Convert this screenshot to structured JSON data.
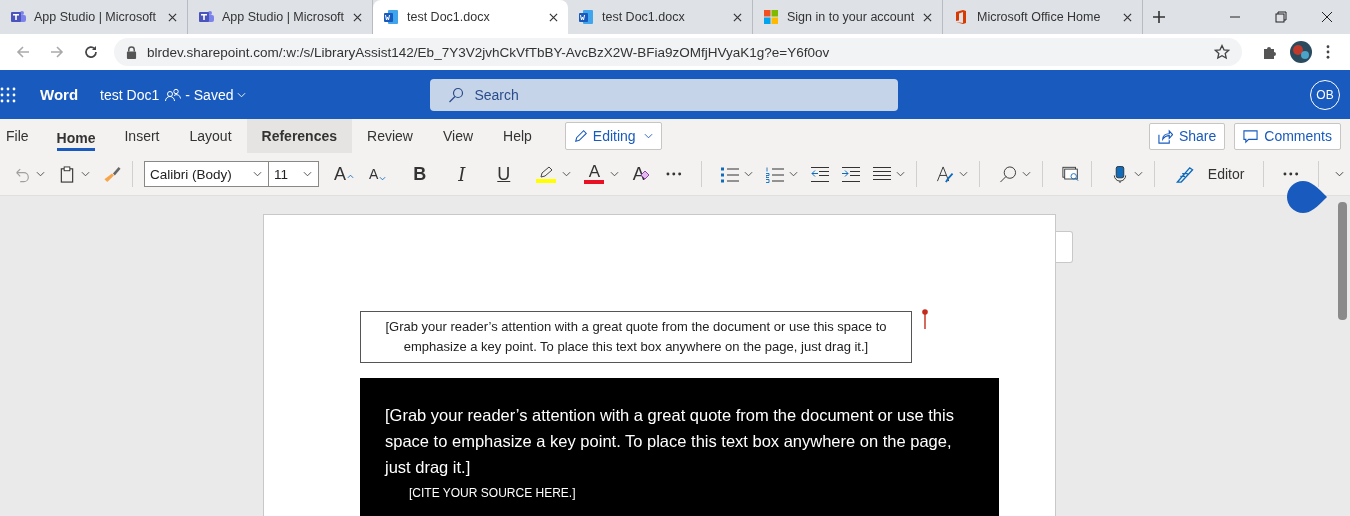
{
  "browser": {
    "tabs": [
      {
        "title": "App Studio | Microsoft",
        "kind": "teams",
        "selected": false
      },
      {
        "title": "App Studio | Microsoft",
        "kind": "teams",
        "selected": false
      },
      {
        "title": "test Doc1.docx",
        "kind": "word",
        "selected": true
      },
      {
        "title": "test Doc1.docx",
        "kind": "word",
        "selected": false
      },
      {
        "title": "Sign in to your account",
        "kind": "microsoft",
        "selected": false
      },
      {
        "title": "Microsoft Office Home",
        "kind": "office",
        "selected": false
      }
    ],
    "address": "blrdev.sharepoint.com/:w:/s/LibraryAssist142/Eb_7Y3V2jvhCkVfTbBY-AvcBzX2W-BFia9zOMfjHVyaK1g?e=Y6f0ov"
  },
  "header": {
    "app_name": "Word",
    "doc_title": "test Doc1",
    "status": "- Saved",
    "search": {
      "placeholder": "Search"
    },
    "avatar": "OB"
  },
  "ribbon_tabs": [
    {
      "label": "File",
      "selected": false,
      "highlighted": false
    },
    {
      "label": "Home",
      "selected": true,
      "highlighted": false
    },
    {
      "label": "Insert",
      "selected": false,
      "highlighted": false
    },
    {
      "label": "Layout",
      "selected": false,
      "highlighted": false
    },
    {
      "label": "References",
      "selected": false,
      "highlighted": true
    },
    {
      "label": "Review",
      "selected": false,
      "highlighted": false
    },
    {
      "label": "View",
      "selected": false,
      "highlighted": false
    },
    {
      "label": "Help",
      "selected": false,
      "highlighted": false
    }
  ],
  "mode_button": "Editing",
  "share_button": "Share",
  "comments_button": "Comments",
  "toolbar": {
    "font": "Calibri (Body)",
    "size": "11",
    "format_buttons": [
      {
        "kind": "grow",
        "glyph": "A"
      },
      {
        "kind": "shrink",
        "glyph": "A"
      },
      {
        "kind": "bold",
        "glyph": "B"
      },
      {
        "kind": "italic",
        "glyph": "I"
      },
      {
        "kind": "underline",
        "glyph": "U"
      }
    ],
    "color_tools": [
      {
        "kind": "highlight",
        "color": "#ffff00"
      },
      {
        "kind": "font-color",
        "glyph": "A",
        "color": "#e81123"
      }
    ],
    "clear_glyph": "A",
    "editor": "Editor"
  },
  "document": {
    "pull_quote": "[Grab your reader’s attention with a great quote from the document or use this space to emphasize a key point. To place this text box anywhere on the page, just drag it.]",
    "quote_box": {
      "text": "[Grab your reader’s attention with a great quote from the document or use this space to emphasize a key point. To place this text box anywhere on the page, just drag it.]",
      "cite": "[CITE YOUR SOURCE HERE.]"
    }
  }
}
